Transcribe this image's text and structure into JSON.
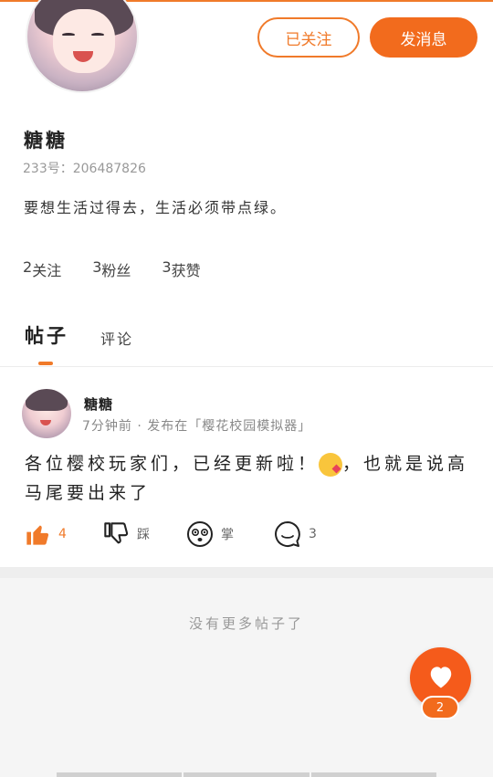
{
  "profile": {
    "follow_button_label": "已关注",
    "message_button_label": "发消息",
    "username": "糖糖",
    "user_id": "233号：206487826",
    "bio": "要想生活过得去，生活必须带点绿。"
  },
  "stats": [
    {
      "count": "2",
      "label": "关注"
    },
    {
      "count": "3",
      "label": "粉丝"
    },
    {
      "count": "3",
      "label": "获赞"
    }
  ],
  "tabs": {
    "posts": "帖子",
    "comments": "评论"
  },
  "post": {
    "author": "糖糖",
    "meta": "7分钟前 · 发布在「樱花校园模拟器」",
    "text_before_emoji": "各位樱校玩家们，已经更新啦！",
    "text_after_emoji": "，也就是说高马尾要出来了",
    "actions": {
      "like_count": "4",
      "dislike_label": "踩",
      "wow_label": "掌",
      "comment_count": "3"
    }
  },
  "footer": {
    "no_more_text": "没有更多帖子了"
  },
  "fab": {
    "badge_count": "2"
  },
  "colors": {
    "accent": "#f07a2a",
    "accent_fill": "#f26b1d"
  },
  "icons": [
    "thumbs-up-icon",
    "thumbs-down-icon",
    "wow-face-icon",
    "comment-bubble-icon",
    "heart-icon",
    "kiss-emoji-icon"
  ]
}
